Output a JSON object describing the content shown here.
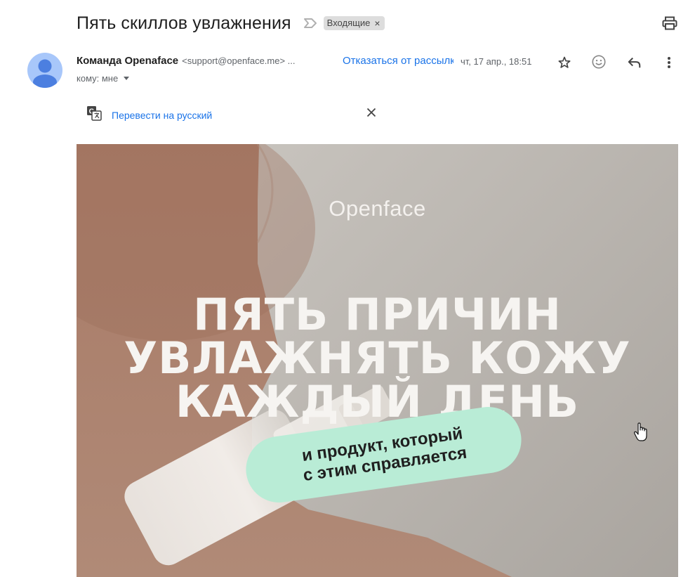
{
  "email": {
    "subject": "Пять скиллов увлажнения",
    "label": "Входящие",
    "sender_name": "Команда Openaface",
    "sender_email": "<support@openface.me> ...",
    "unsubscribe": "Отказаться от рассылки",
    "date": "чт, 17 апр., 18:51",
    "to": "кому: мне"
  },
  "translate": {
    "link": "Перевести на русский"
  },
  "banner": {
    "brand": "Openface",
    "headline": [
      "ПЯТЬ ПРИЧИН",
      "УВЛАЖНЯТЬ КОЖУ",
      "КАЖДЫЙ ДЕНЬ"
    ],
    "pill": [
      "и продукт, который",
      "с этим справляется"
    ]
  },
  "icons": [
    "importance-icon",
    "print-icon",
    "star-icon",
    "emoji-icon",
    "reply-icon",
    "more-icon",
    "translate-icon",
    "close-icon",
    "hand-cursor-icon"
  ],
  "colors": {
    "link": "#1a73e8",
    "banner_bg": "#b18b78",
    "pill": "#b9ecd6",
    "avatar": "#a8c7fa"
  }
}
